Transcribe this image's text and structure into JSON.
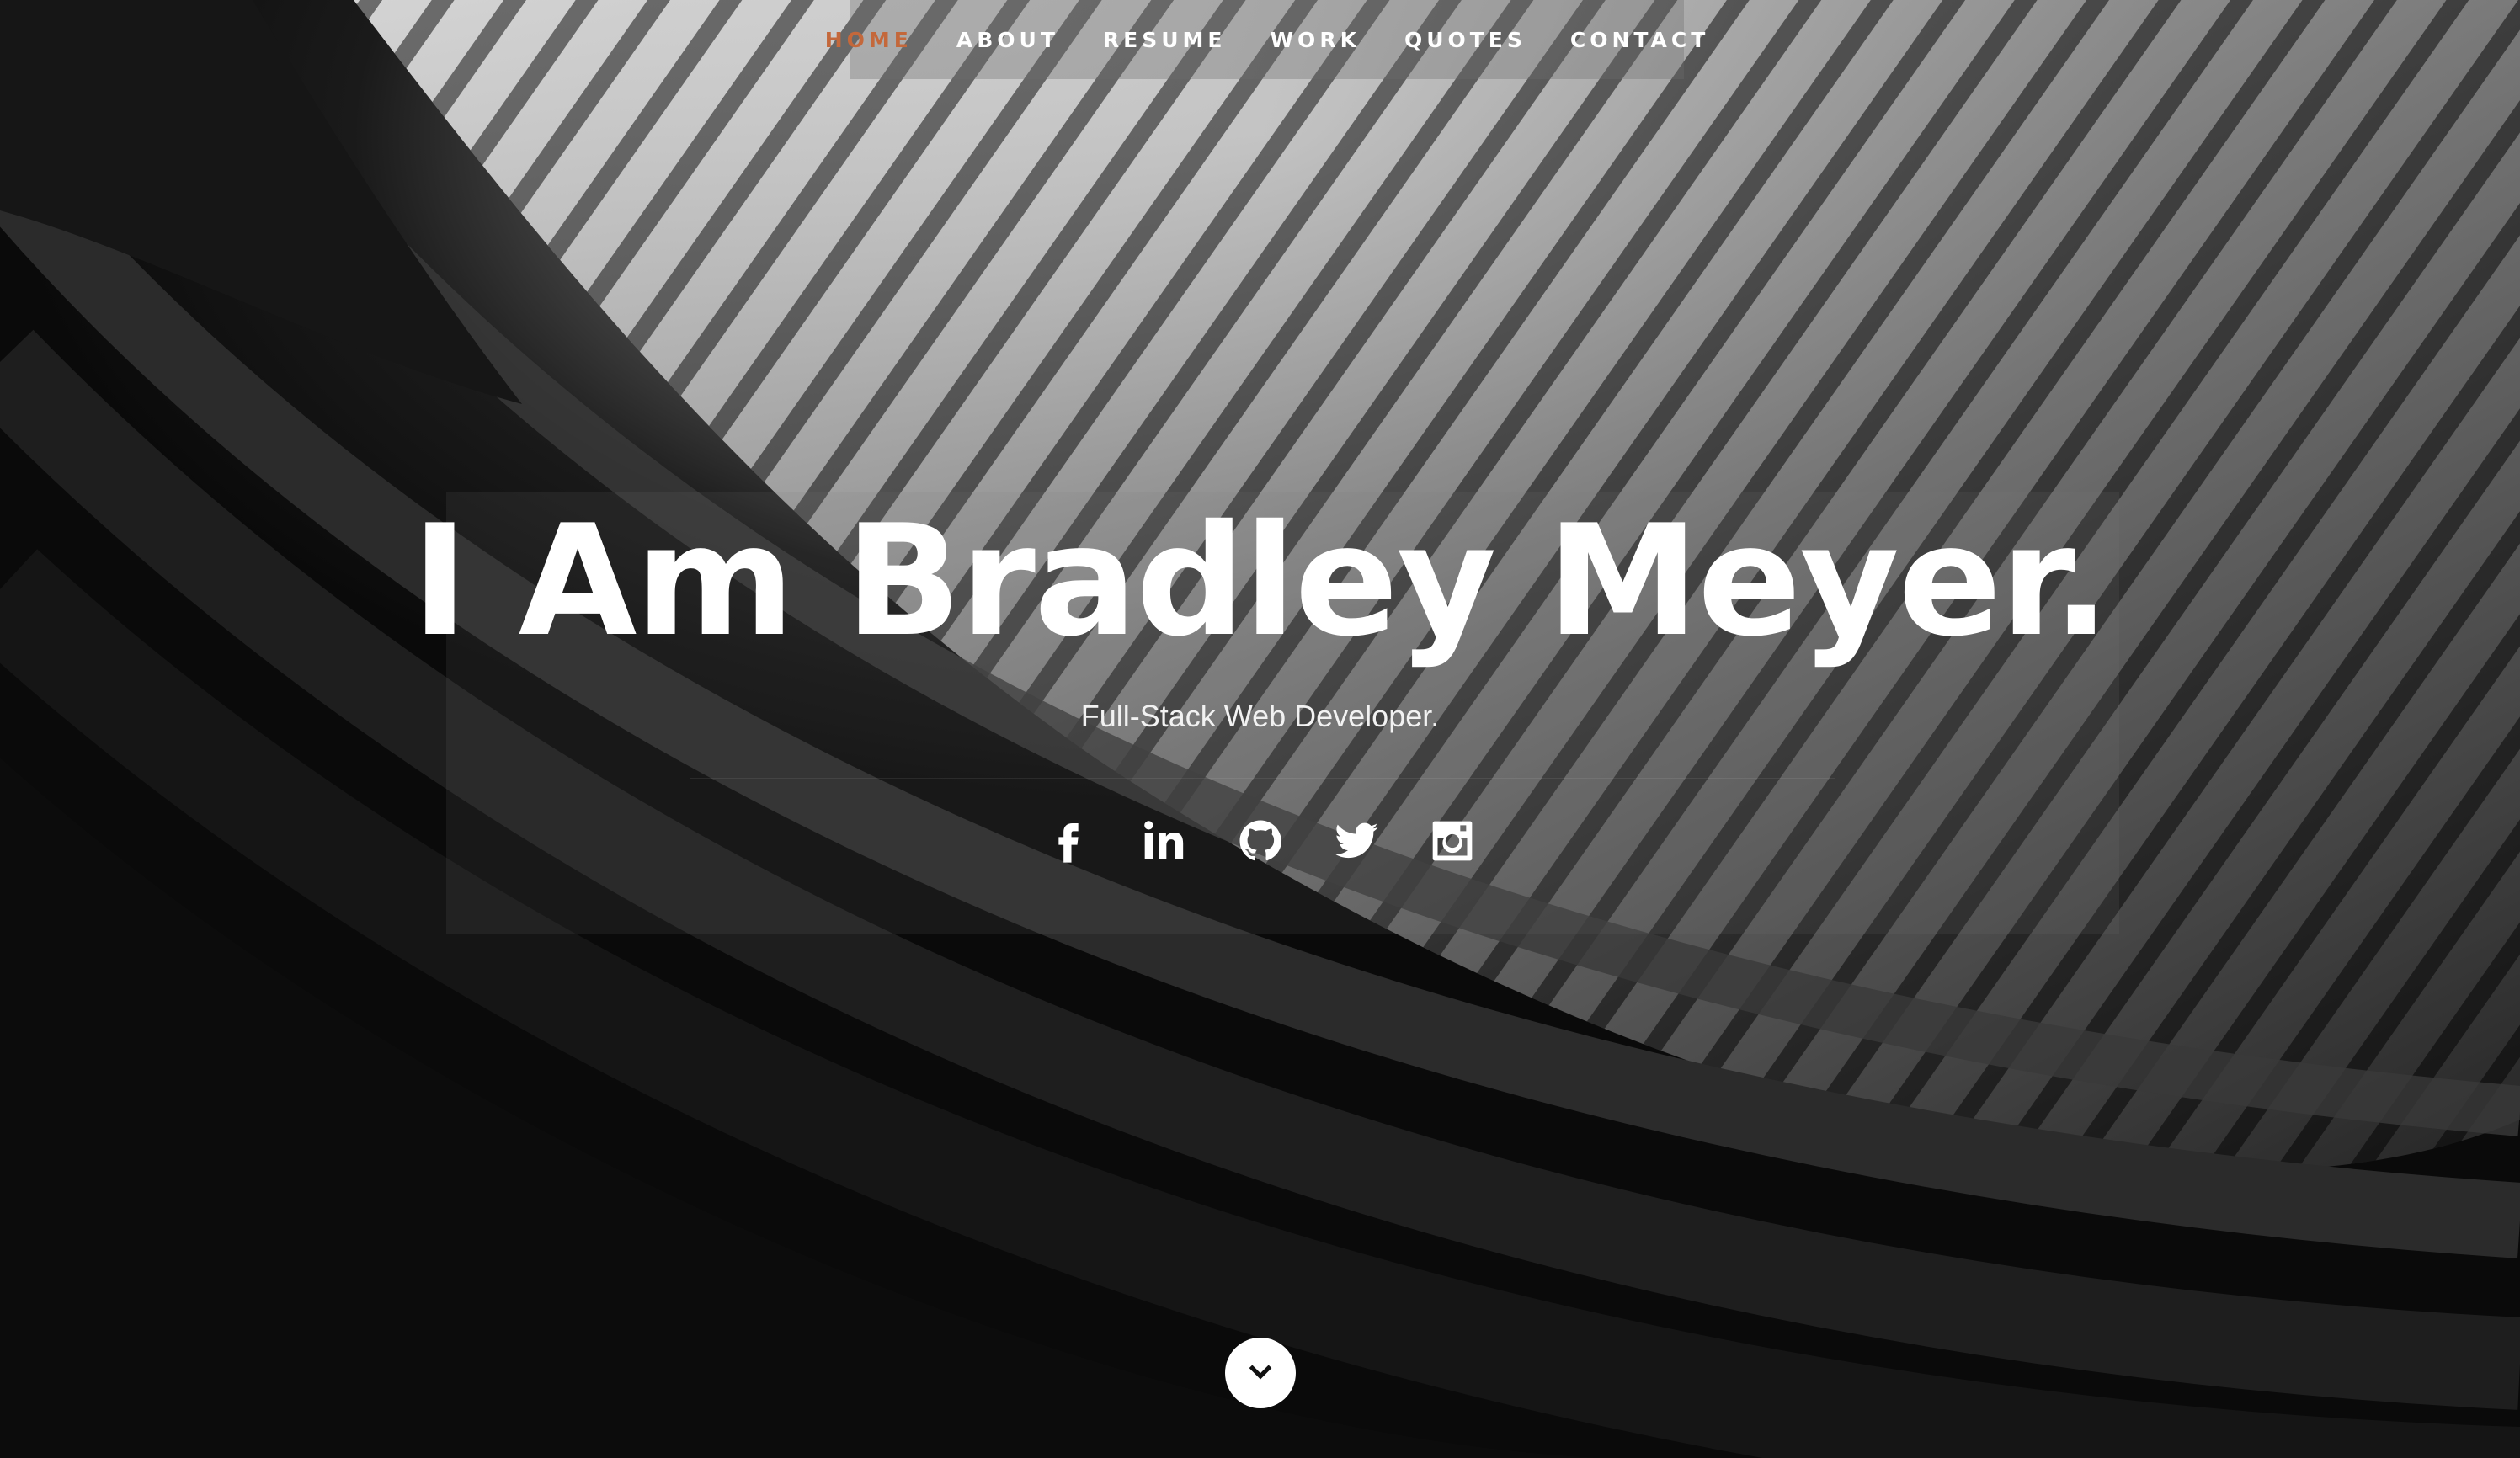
{
  "nav": {
    "items": [
      {
        "label": "HOME",
        "active": true
      },
      {
        "label": "ABOUT",
        "active": false
      },
      {
        "label": "RESUME",
        "active": false
      },
      {
        "label": "WORK",
        "active": false
      },
      {
        "label": "QUOTES",
        "active": false
      },
      {
        "label": "CONTACT",
        "active": false
      }
    ],
    "active_color": "#c4683b"
  },
  "banner": {
    "headline": "I Am Bradley Meyer.",
    "subtitle": "Full-Stack Web Developer."
  },
  "social": [
    {
      "icon": "facebook-icon"
    },
    {
      "icon": "linkedin-icon"
    },
    {
      "icon": "github-icon"
    },
    {
      "icon": "twitter-icon"
    },
    {
      "icon": "instagram-icon"
    }
  ],
  "scroll": {
    "icon": "chevron-down-icon"
  }
}
